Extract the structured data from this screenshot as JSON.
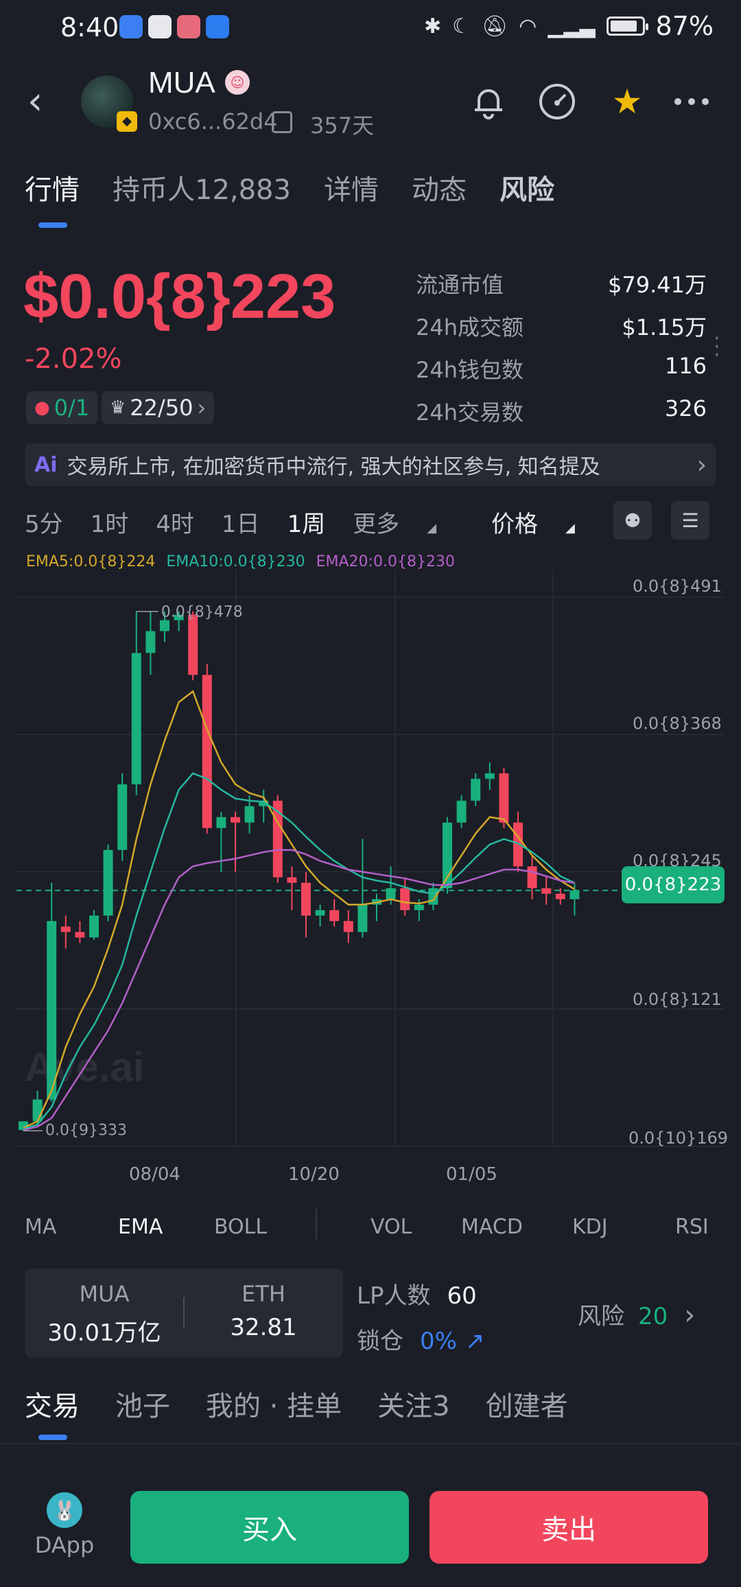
{
  "status_bar": {
    "time": "8:40",
    "battery": "87%"
  },
  "header": {
    "token_name": "MUA",
    "address": "0xc6...62d4",
    "age": "357天",
    "icons": [
      "back-icon",
      "bell-icon",
      "gauge-icon",
      "star-icon",
      "more-icon"
    ]
  },
  "tabs": [
    {
      "label": "行情"
    },
    {
      "label": "持币人12,883"
    },
    {
      "label": "详情"
    },
    {
      "label": "动态"
    },
    {
      "label": "风险"
    }
  ],
  "price": {
    "value": "$0.0{8}223",
    "change": "-2.02%",
    "chip1_value": "0/1",
    "chip2_value": "22/50"
  },
  "stats": [
    {
      "label": "流通市值",
      "value": "$79.41万"
    },
    {
      "label": "24h成交额",
      "value": "$1.15万"
    },
    {
      "label": "24h钱包数",
      "value": "116"
    },
    {
      "label": "24h交易数",
      "value": "326"
    }
  ],
  "ai_summary": "交易所上市, 在加密货币中流行, 强大的社区参与, 知名提及",
  "intervals": [
    "5分",
    "1时",
    "4时",
    "1日",
    "1周",
    "更多",
    "价格"
  ],
  "active_interval": "1周",
  "ema_legend": [
    {
      "label": "EMA5:0.0{8}224",
      "color": "#d4a82a"
    },
    {
      "label": "EMA10:0.0{8}230",
      "color": "#26b7a0"
    },
    {
      "label": "EMA20:0.0{8}230",
      "color": "#b35fc8"
    }
  ],
  "chart": {
    "y_labels": [
      "0.0{8}491",
      "0.0{8}368",
      "0.0{8}245",
      "0.0{8}121",
      "0.0{10}169"
    ],
    "x_labels": [
      "08/04",
      "10/20",
      "01/05"
    ],
    "high_label": "0.0{8}478",
    "low_label": "0.0{9}333",
    "current_price_tag": "0.0{8}223",
    "watermark": "Ave.ai"
  },
  "chart_data": {
    "type": "candlestick",
    "y_units": "price ×1e-8",
    "ylim": [
      0.0169,
      4.91
    ],
    "candles": [
      {
        "o": 0.04,
        "h": 0.12,
        "l": 0.0333,
        "c": 0.12
      },
      {
        "o": 0.12,
        "h": 0.4,
        "l": 0.08,
        "c": 0.32
      },
      {
        "o": 0.32,
        "h": 2.3,
        "l": 0.3,
        "c": 1.95
      },
      {
        "o": 1.9,
        "h": 2.0,
        "l": 1.7,
        "c": 1.85
      },
      {
        "o": 1.85,
        "h": 1.95,
        "l": 1.75,
        "c": 1.8
      },
      {
        "o": 1.8,
        "h": 2.05,
        "l": 1.78,
        "c": 2.0
      },
      {
        "o": 2.0,
        "h": 2.65,
        "l": 1.95,
        "c": 2.6
      },
      {
        "o": 2.6,
        "h": 3.3,
        "l": 2.5,
        "c": 3.2
      },
      {
        "o": 3.2,
        "h": 4.78,
        "l": 3.1,
        "c": 4.4
      },
      {
        "o": 4.4,
        "h": 4.78,
        "l": 4.2,
        "c": 4.6
      },
      {
        "o": 4.6,
        "h": 4.78,
        "l": 4.5,
        "c": 4.7
      },
      {
        "o": 4.7,
        "h": 4.78,
        "l": 4.6,
        "c": 4.75
      },
      {
        "o": 4.75,
        "h": 4.78,
        "l": 4.15,
        "c": 4.2
      },
      {
        "o": 4.2,
        "h": 4.3,
        "l": 2.75,
        "c": 2.8
      },
      {
        "o": 2.8,
        "h": 2.95,
        "l": 2.4,
        "c": 2.9
      },
      {
        "o": 2.9,
        "h": 2.95,
        "l": 2.4,
        "c": 2.85
      },
      {
        "o": 2.85,
        "h": 3.1,
        "l": 2.75,
        "c": 3.0
      },
      {
        "o": 3.0,
        "h": 3.15,
        "l": 2.85,
        "c": 3.05
      },
      {
        "o": 3.05,
        "h": 3.1,
        "l": 2.3,
        "c": 2.35
      },
      {
        "o": 2.35,
        "h": 2.45,
        "l": 2.05,
        "c": 2.3
      },
      {
        "o": 2.3,
        "h": 2.4,
        "l": 1.8,
        "c": 2.0
      },
      {
        "o": 2.0,
        "h": 2.1,
        "l": 1.9,
        "c": 2.05
      },
      {
        "o": 2.05,
        "h": 2.15,
        "l": 1.9,
        "c": 1.95
      },
      {
        "o": 1.95,
        "h": 2.05,
        "l": 1.75,
        "c": 1.85
      },
      {
        "o": 1.85,
        "h": 2.7,
        "l": 1.8,
        "c": 2.1
      },
      {
        "o": 2.1,
        "h": 2.2,
        "l": 1.95,
        "c": 2.15
      },
      {
        "o": 2.15,
        "h": 2.45,
        "l": 2.1,
        "c": 2.25
      },
      {
        "o": 2.25,
        "h": 2.35,
        "l": 2.0,
        "c": 2.05
      },
      {
        "o": 2.05,
        "h": 2.15,
        "l": 1.95,
        "c": 2.1
      },
      {
        "o": 2.1,
        "h": 2.3,
        "l": 2.05,
        "c": 2.25
      },
      {
        "o": 2.25,
        "h": 2.9,
        "l": 2.2,
        "c": 2.85
      },
      {
        "o": 2.85,
        "h": 3.1,
        "l": 2.8,
        "c": 3.05
      },
      {
        "o": 3.05,
        "h": 3.3,
        "l": 3.0,
        "c": 3.25
      },
      {
        "o": 3.25,
        "h": 3.4,
        "l": 3.15,
        "c": 3.3
      },
      {
        "o": 3.3,
        "h": 3.35,
        "l": 2.8,
        "c": 2.85
      },
      {
        "o": 2.85,
        "h": 2.95,
        "l": 2.4,
        "c": 2.45
      },
      {
        "o": 2.45,
        "h": 2.55,
        "l": 2.15,
        "c": 2.25
      },
      {
        "o": 2.25,
        "h": 2.35,
        "l": 2.1,
        "c": 2.2
      },
      {
        "o": 2.2,
        "h": 2.25,
        "l": 2.1,
        "c": 2.15
      },
      {
        "o": 2.15,
        "h": 2.3,
        "l": 2.0,
        "c": 2.23
      }
    ],
    "ema": [
      {
        "name": "EMA5",
        "color": "#d4a82a",
        "values": [
          0.06,
          0.12,
          0.4,
          0.8,
          1.1,
          1.35,
          1.7,
          2.1,
          2.7,
          3.2,
          3.6,
          3.95,
          4.05,
          3.7,
          3.4,
          3.2,
          3.12,
          3.08,
          2.85,
          2.65,
          2.45,
          2.3,
          2.2,
          2.1,
          2.1,
          2.12,
          2.15,
          2.12,
          2.11,
          2.14,
          2.35,
          2.55,
          2.75,
          2.9,
          2.88,
          2.72,
          2.55,
          2.42,
          2.32,
          2.24
        ]
      },
      {
        "name": "EMA10",
        "color": "#26b7a0",
        "values": [
          0.05,
          0.09,
          0.25,
          0.55,
          0.8,
          1.0,
          1.25,
          1.55,
          2.0,
          2.4,
          2.8,
          3.15,
          3.3,
          3.25,
          3.15,
          3.07,
          3.05,
          3.04,
          2.95,
          2.85,
          2.72,
          2.6,
          2.5,
          2.42,
          2.35,
          2.32,
          2.3,
          2.26,
          2.22,
          2.2,
          2.28,
          2.4,
          2.53,
          2.65,
          2.7,
          2.66,
          2.58,
          2.48,
          2.36,
          2.3
        ]
      },
      {
        "name": "EMA20",
        "color": "#b35fc8",
        "values": [
          0.04,
          0.07,
          0.15,
          0.35,
          0.55,
          0.75,
          0.95,
          1.2,
          1.5,
          1.8,
          2.1,
          2.35,
          2.45,
          2.48,
          2.5,
          2.52,
          2.55,
          2.58,
          2.6,
          2.6,
          2.56,
          2.5,
          2.46,
          2.42,
          2.4,
          2.38,
          2.36,
          2.34,
          2.31,
          2.28,
          2.28,
          2.3,
          2.34,
          2.38,
          2.42,
          2.42,
          2.4,
          2.36,
          2.32,
          2.3
        ]
      }
    ]
  },
  "indicators": [
    "MA",
    "EMA",
    "BOLL",
    "VOL",
    "MACD",
    "KDJ",
    "RSI"
  ],
  "active_indicator": "EMA",
  "pair": {
    "base_symbol": "MUA",
    "base_amount": "30.01万亿",
    "quote_symbol": "ETH",
    "quote_amount": "32.81"
  },
  "lp": {
    "holders_label": "LP人数",
    "holders_value": "60",
    "lock_label": "锁仓",
    "lock_value": "0%"
  },
  "risk": {
    "label": "风险",
    "value": "20"
  },
  "bottom_tabs": [
    "交易",
    "池子",
    "我的 · 挂单",
    "关注3",
    "创建者"
  ],
  "bottom_bar": {
    "dapp_label": "DApp",
    "buy_label": "买入",
    "sell_label": "卖出"
  }
}
